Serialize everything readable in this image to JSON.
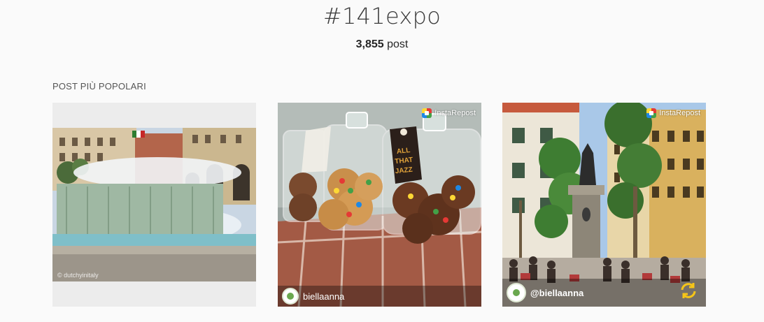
{
  "header": {
    "title": "#141expo",
    "post_count": "3,855",
    "post_label": " post"
  },
  "section": {
    "label": "POST PIÙ POPOLARI"
  },
  "posts": [
    {
      "alt": "Fontana in piazza",
      "watermark": "© dutchyinitaly"
    },
    {
      "alt": "Barattoli di biscotti",
      "jar_label_line1": "ALL",
      "jar_label_line2": "THAT",
      "jar_label_line3": "JAZZ",
      "repost_label": "InstaRepost",
      "username": "biellaanna"
    },
    {
      "alt": "Piazza con statua",
      "repost_label": "InstaRepost",
      "username": "@biellaanna"
    }
  ],
  "colors": {
    "background": "#fafafa",
    "text": "#262626",
    "accent_refresh": "#f5c518"
  }
}
